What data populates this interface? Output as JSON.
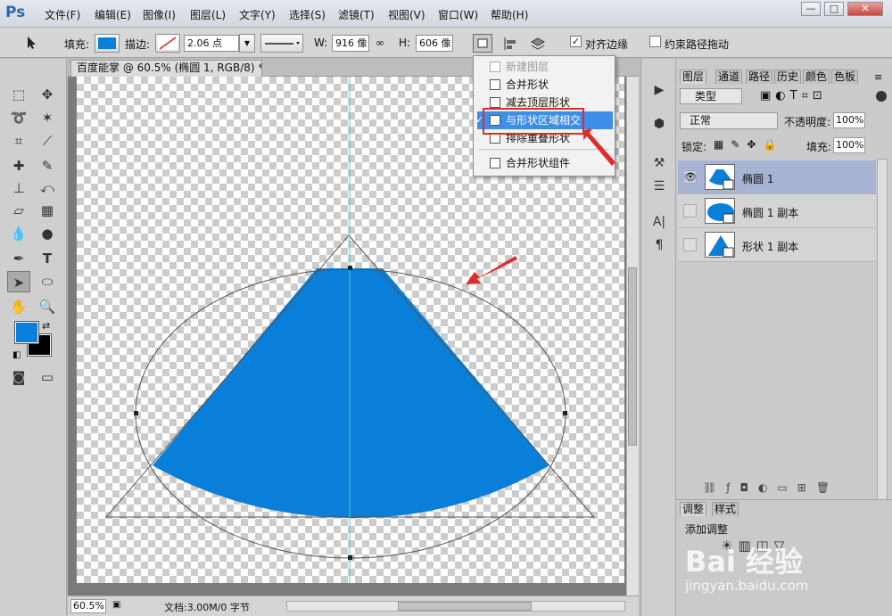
{
  "app": {
    "logo": "Ps"
  },
  "menubar": {
    "items": [
      "文件(F)",
      "编辑(E)",
      "图像(I)",
      "图层(L)",
      "文字(Y)",
      "选择(S)",
      "滤镜(T)",
      "视图(V)",
      "窗口(W)",
      "帮助(H)"
    ],
    "window_buttons": {
      "minimize": "—",
      "maximize": "□",
      "close": "✕"
    }
  },
  "options": {
    "fill_label": "填充:",
    "fill_color": "#0a7fd9",
    "stroke_label": "描边:",
    "stroke_width": "2.06 点",
    "w_label": "W:",
    "w_value": "916 像",
    "h_label": "H:",
    "h_value": "606 像",
    "align_edges_label": "对齐边缘",
    "align_edges_checked": "✓",
    "constrain_label": "约束路径拖动"
  },
  "path_ops_menu": {
    "items": [
      {
        "label": "新建图层",
        "disabled": true
      },
      {
        "label": "合并形状",
        "disabled": false
      },
      {
        "label": "减去顶层形状",
        "disabled": false
      },
      {
        "label": "与形状区域相交",
        "disabled": false,
        "selected": true,
        "check": "✓"
      },
      {
        "label": "排除重叠形状",
        "disabled": false
      },
      {
        "label": "合并形状组件",
        "disabled": false
      }
    ]
  },
  "document": {
    "tab_title": "百度能掌 @ 60.5% (椭圆 1, RGB/8) *",
    "zoom": "60.5%",
    "doc_size": "文档:3.00M/0 字节",
    "shape_color": "#0a7fd9"
  },
  "layers_panel": {
    "tabs": [
      "图层",
      "通道",
      "路径",
      "历史",
      "颜色",
      "色板"
    ],
    "filter_type": "类型",
    "blend_mode": "正常",
    "opacity_label": "不透明度:",
    "opacity_value": "100%",
    "lock_label": "锁定:",
    "fill_label": "填充:",
    "fill_value": "100%",
    "layers": [
      {
        "name": "椭圆 1",
        "visible": true,
        "selected": true
      },
      {
        "name": "椭圆 1 副本",
        "visible": false,
        "selected": false
      },
      {
        "name": "形状 1 副本",
        "visible": false,
        "selected": false
      }
    ]
  },
  "adjust_panel": {
    "tabs": [
      "调整",
      "样式"
    ],
    "title": "添加调整"
  },
  "watermark": {
    "main": "Bai 经验",
    "url": "jingyan.baidu.com"
  },
  "tools": {
    "foreground": "#0a7fd9",
    "background": "#000000"
  }
}
